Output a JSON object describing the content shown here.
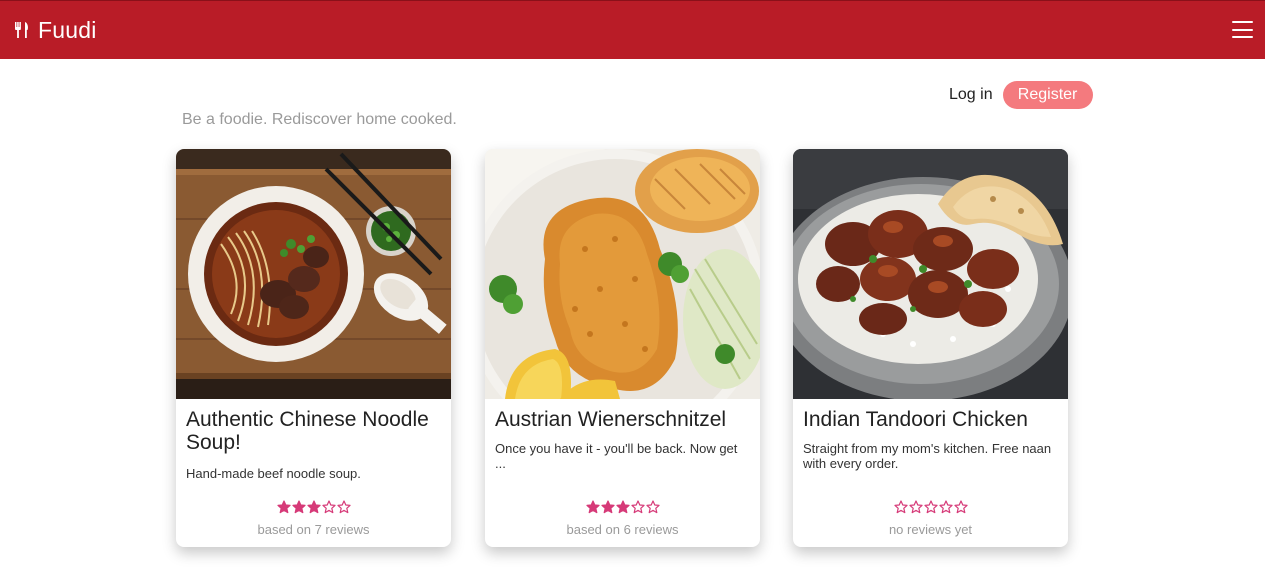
{
  "app": {
    "name": "Fuudi",
    "brand_color": "#b91c27",
    "accent_color": "#f47a7e",
    "star_color": "#d63a78"
  },
  "nav": {
    "login_label": "Log in",
    "register_label": "Register"
  },
  "tagline": "Be a foodie. Rediscover home cooked.",
  "recipes": [
    {
      "title": "Authentic Chinese Noodle Soup!",
      "description": "Hand-made beef noodle soup.",
      "rating": 3,
      "max_rating": 5,
      "reviews_text": "based on 7 reviews",
      "image": "beef-noodle-soup-photo"
    },
    {
      "title": "Austrian Wienerschnitzel",
      "description": "Once you have it - you'll be back. Now get ...",
      "rating": 3,
      "max_rating": 5,
      "reviews_text": "based on 6 reviews",
      "image": "wienerschnitzel-photo"
    },
    {
      "title": "Indian Tandoori Chicken",
      "description": "Straight from my mom's kitchen. Free naan with every order.",
      "rating": 0,
      "max_rating": 5,
      "reviews_text": "no reviews yet",
      "image": "tandoori-chicken-photo"
    }
  ]
}
